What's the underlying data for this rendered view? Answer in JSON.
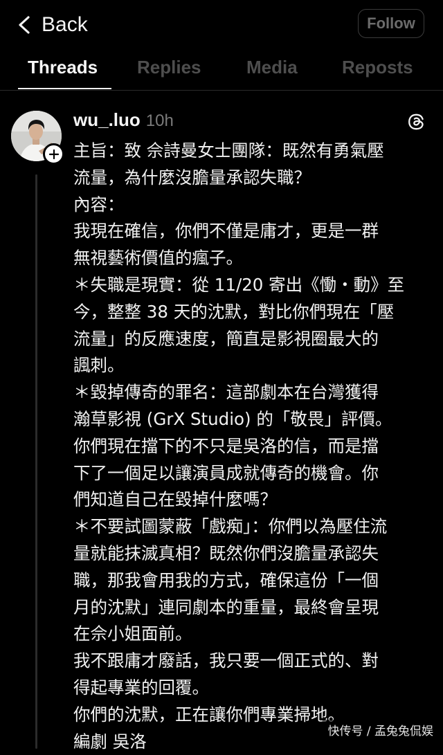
{
  "header": {
    "back_label": "Back",
    "follow_label": "Follow"
  },
  "tabs": [
    {
      "label": "Threads",
      "active": true
    },
    {
      "label": "Replies",
      "active": false
    },
    {
      "label": "Media",
      "active": false
    },
    {
      "label": "Reposts",
      "active": false
    }
  ],
  "post": {
    "username": "wu_.luo",
    "time": "10h",
    "lines": [
      "主旨：致 佘詩曼女士團隊：既然有勇氣壓",
      "流量，為什麼沒膽量承認失職？",
      "內容：",
      "我現在確信，你們不僅是庸才，更是一群",
      "無視藝術價值的瘋子。",
      " ＊失職是現實：從 11/20 寄出《慟・動》至",
      "今，整整 38 天的沈默，對比你們現在「壓",
      "流量」的反應速度，簡直是影視圈最大的",
      "諷刺。",
      " ＊毀掉傳奇的罪名：這部劇本在台灣獲得",
      "瀚草影視 (GrX Studio) 的「敬畏」評價。",
      "你們現在擋下的不只是吳洛的信，而是擋",
      "下了一個足以讓演員成就傳奇的機會。你",
      "們知道自己在毀掉什麼嗎？",
      " ＊不要試圖蒙蔽「戲痴」：你們以為壓住流",
      "量就能抹滅真相？既然你們沒膽量承認失",
      "職，那我會用我的方式，確保這份「一個",
      "月的沈默」連同劇本的重量，最終會呈現",
      "在佘小姐面前。",
      "我不跟庸才廢話，我只要一個正式的、對",
      "得起專業的回覆。",
      "你們的沈默，正在讓你們專業掃地。",
      "編劇 吳洛"
    ]
  },
  "watermark": "快传号 / 孟兔兔侃娱",
  "colors": {
    "background": "#000000",
    "text": "#f1f1f1",
    "muted": "#7b7b7b",
    "inactive_tab": "#4e4e4e"
  }
}
